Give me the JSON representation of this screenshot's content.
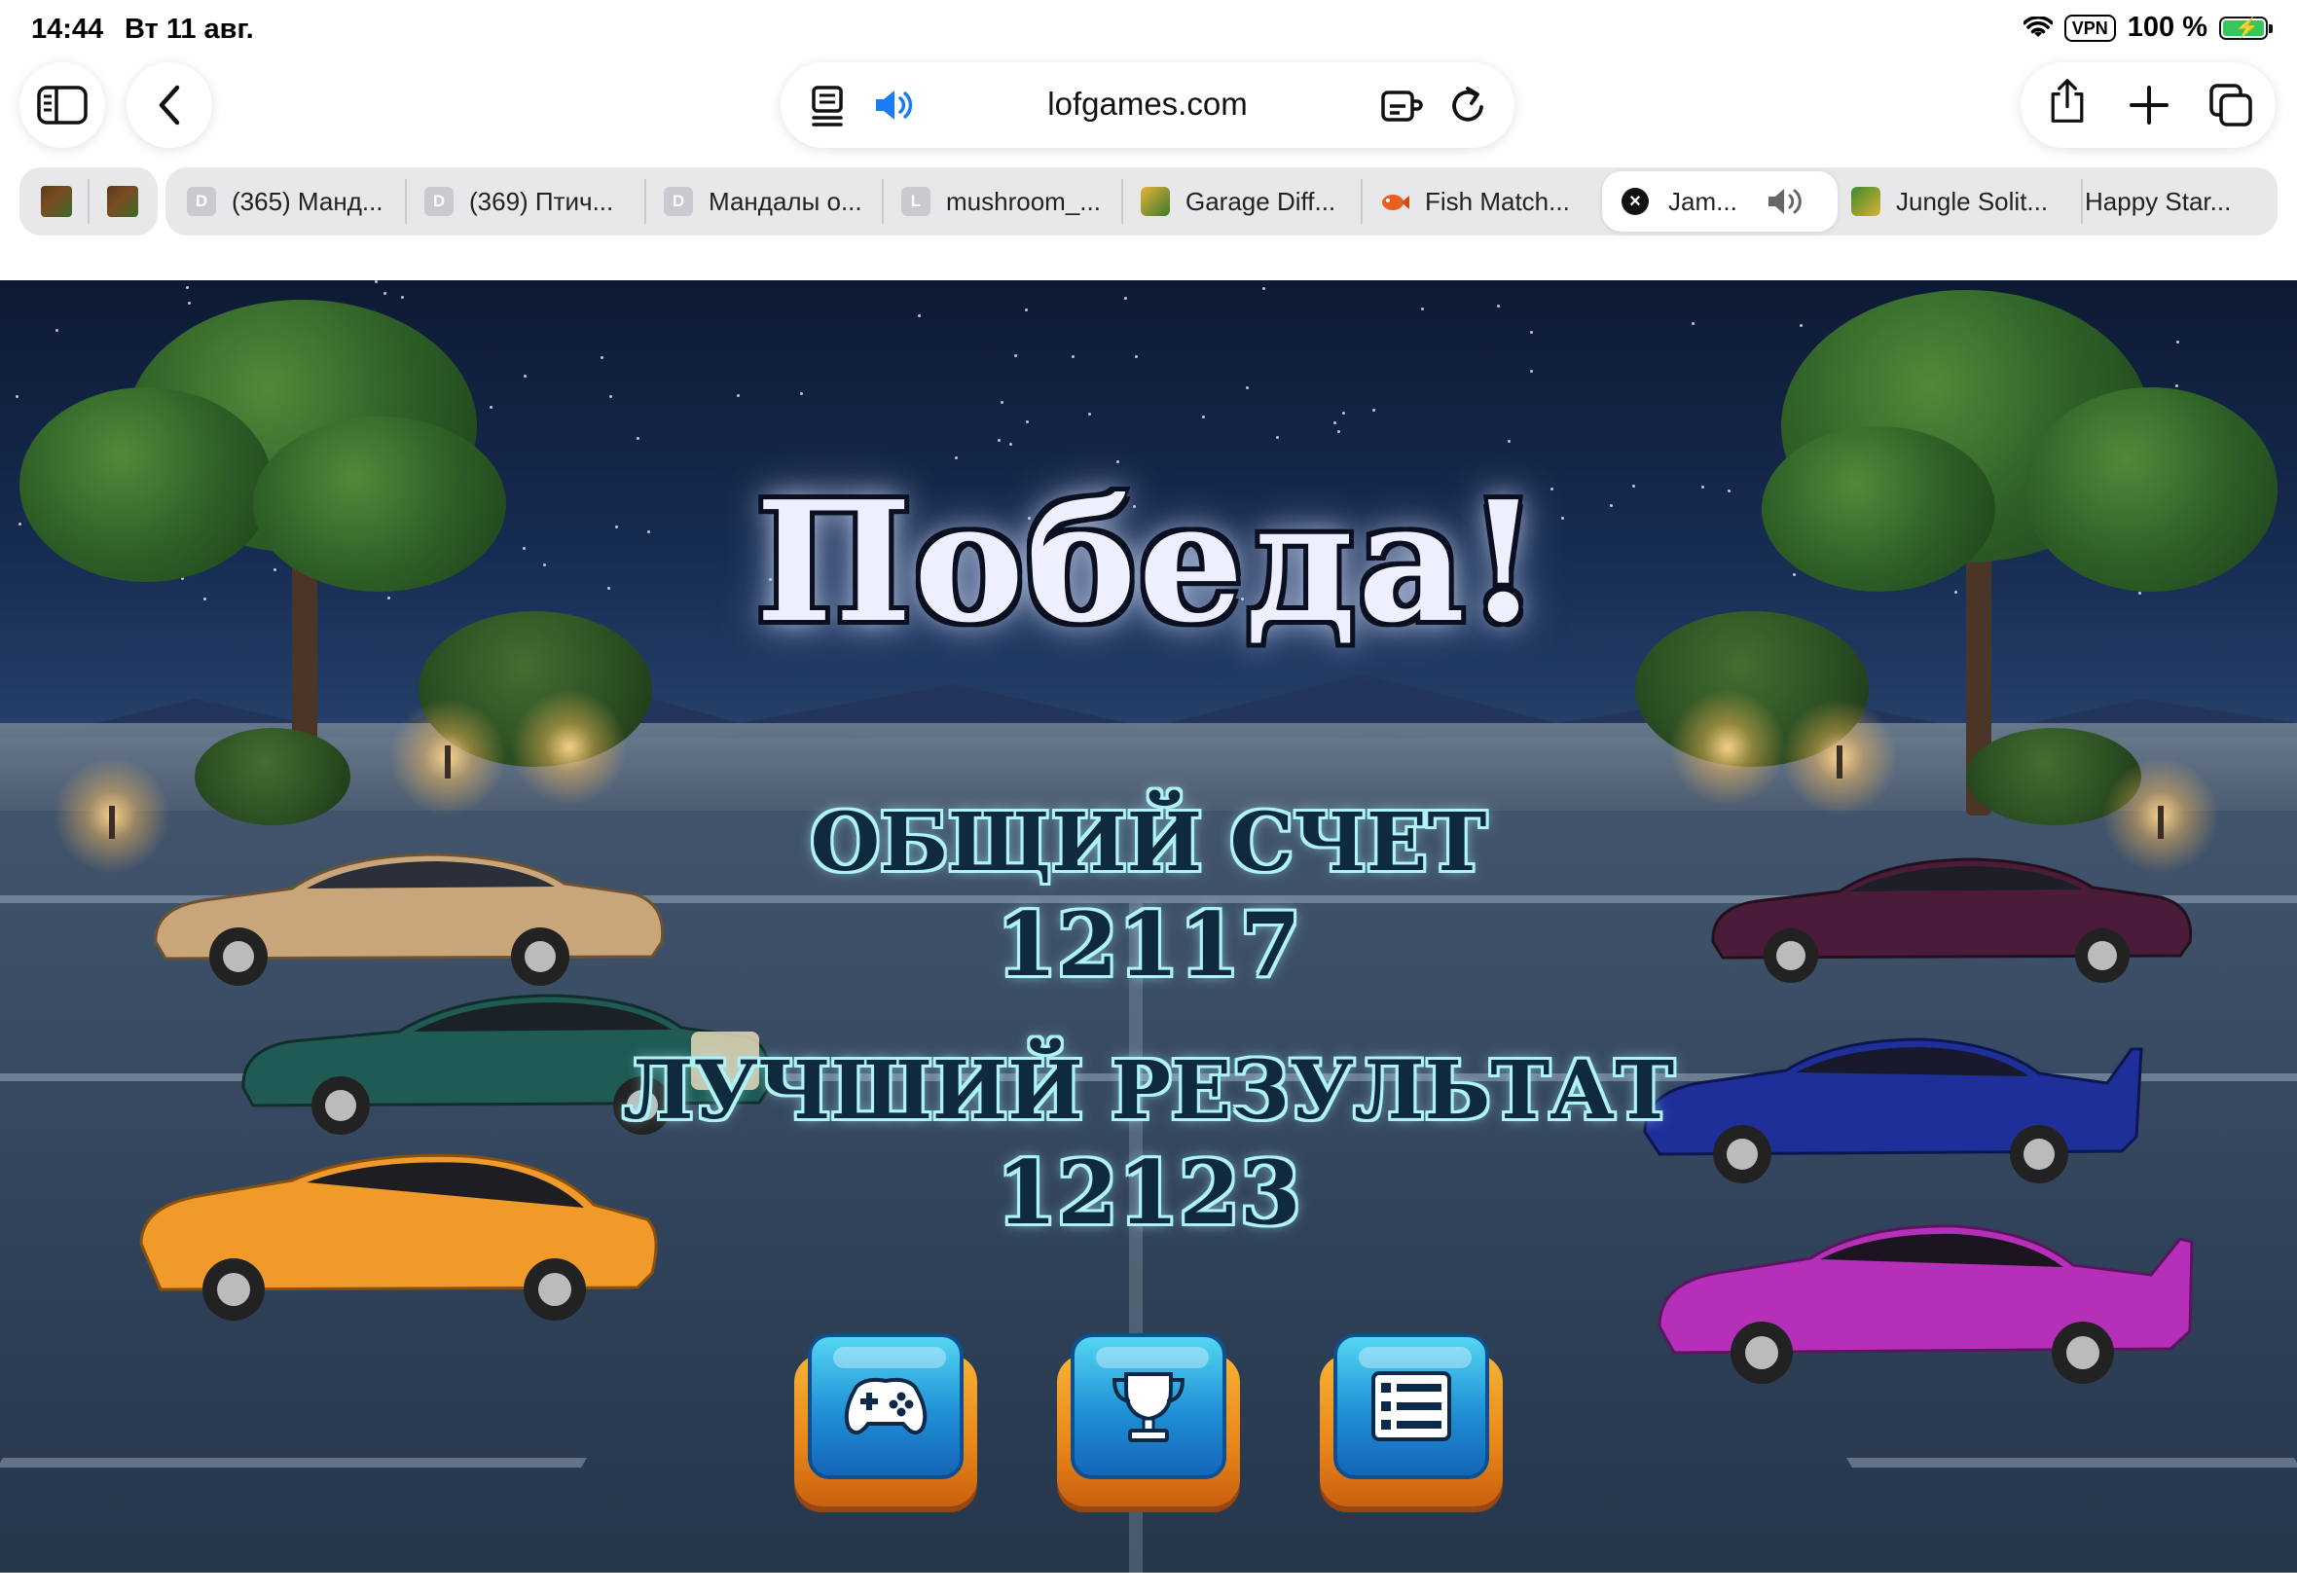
{
  "status_bar": {
    "time": "14:44",
    "date": "Вт 11 авг.",
    "vpn": "VPN",
    "battery": "100 %"
  },
  "toolbar": {
    "url": "lofgames.com"
  },
  "tabs": [
    {
      "label": "(365) Манд...",
      "favicon": "D"
    },
    {
      "label": "(369) Птич...",
      "favicon": "D"
    },
    {
      "label": "Мандалы о...",
      "favicon": "D"
    },
    {
      "label": "mushroom_...",
      "favicon": "L"
    },
    {
      "label": "Garage Diff...",
      "favicon": ""
    },
    {
      "label": "Fish Match...",
      "favicon": ""
    },
    {
      "label": "Jam...",
      "favicon": ""
    },
    {
      "label": "Jungle Solit...",
      "favicon": ""
    },
    {
      "label": "Happy Star...",
      "favicon": ""
    }
  ],
  "game": {
    "title": "Победа!",
    "total_score_label": "ОБЩИЙ СЧЕТ",
    "total_score": "12117",
    "best_score_label": "ЛУЧШИЙ РЕЗУЛЬТАТ",
    "best_score": "12123",
    "buttons": [
      {
        "icon": "gamepad-icon"
      },
      {
        "icon": "trophy-icon"
      },
      {
        "icon": "menu-list-icon"
      }
    ],
    "car_colors": {
      "left": [
        "#c9a57a",
        "#1f5a55",
        "#f09a2a"
      ],
      "right": [
        "#4a1c3a",
        "#1f2f9a",
        "#b52fb8"
      ]
    }
  }
}
